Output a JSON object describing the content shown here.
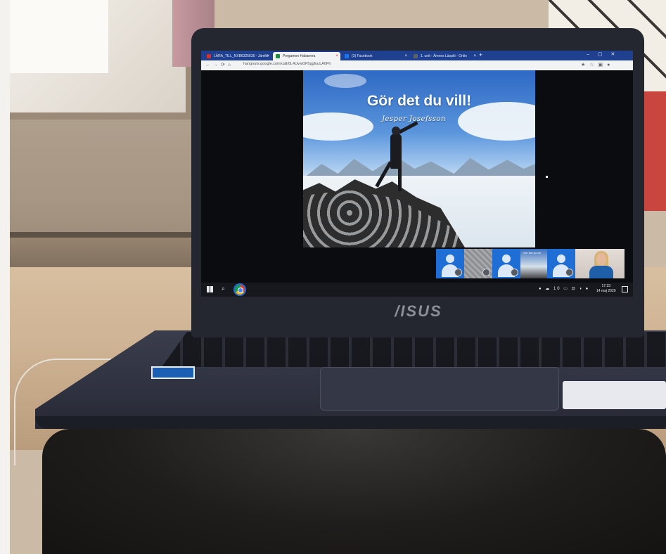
{
  "browser": {
    "tabs": [
      {
        "label": "LÄRA_TILL_NXB6325635 - Jämför",
        "active": false,
        "favicon_color": "#d93025"
      },
      {
        "label": "Pergamon Habanera",
        "active": true,
        "favicon_color": "#1e8e3e"
      },
      {
        "label": "(3) Facebook",
        "active": false,
        "favicon_color": "#1877f2"
      },
      {
        "label": "1. unit - Ämnes Läsplö - Onlin",
        "active": false,
        "favicon_color": "#5f6368"
      }
    ],
    "new_tab": "+",
    "window_controls": "–▢✕",
    "nav_icons": "←→⟳⌂",
    "url": "hangouts.google.com/call/0L4UvwOF5ggfuuLA0Fh",
    "right_icons": "★☆▣●"
  },
  "slide": {
    "title": "Gör det du vill!",
    "author": "Jesper Josefsson"
  },
  "participants": [
    {
      "kind": "avatar",
      "color": "#1f6ed6"
    },
    {
      "kind": "grey"
    },
    {
      "kind": "avatar",
      "color": "#1f6ed6"
    },
    {
      "kind": "mini-slide",
      "label": "Gör det du vill"
    },
    {
      "kind": "avatar",
      "color": "#1f6ed6"
    },
    {
      "kind": "camera"
    }
  ],
  "taskbar": {
    "search_icon": "⌕",
    "tray": "● ☁ 10 ▭ ⊡ ◑ ●",
    "time": "17:33",
    "date": "14 maj 2020"
  },
  "laptop": {
    "brand": "/ISUS"
  }
}
